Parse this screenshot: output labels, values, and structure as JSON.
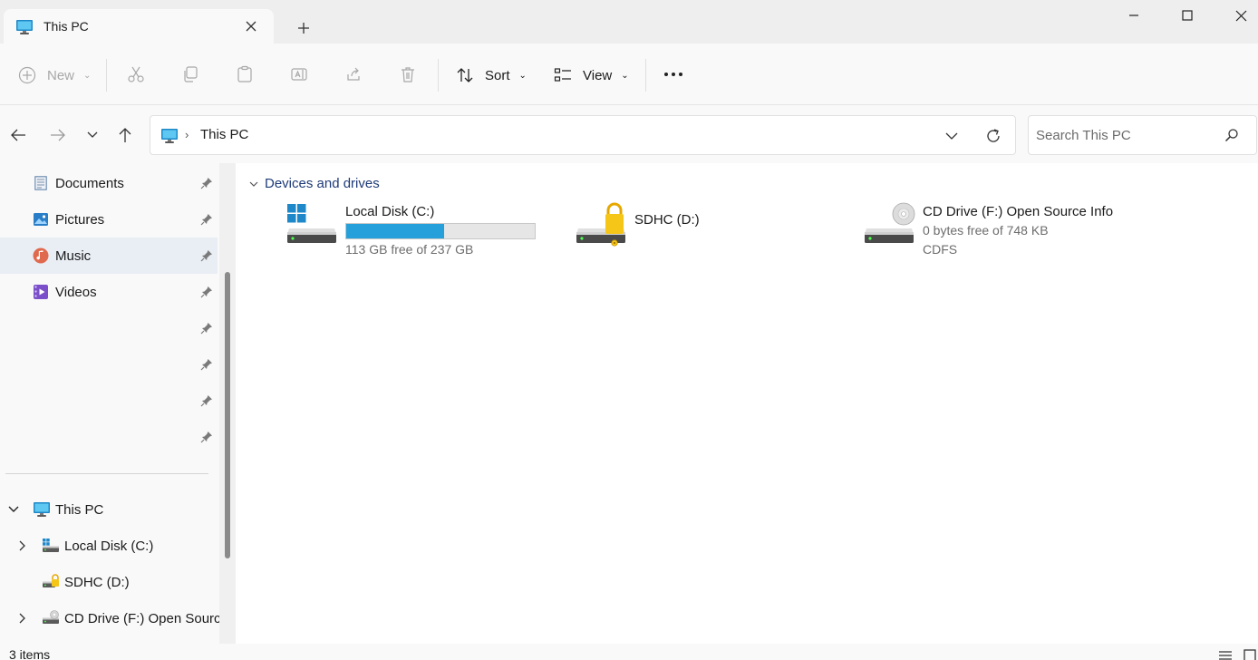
{
  "window": {
    "tab_title": "This PC",
    "colors": {
      "accent": "#26a0da",
      "selection": "#cce4f7",
      "group_header": "#1e3a78"
    }
  },
  "toolbar": {
    "new_label": "New",
    "sort_label": "Sort",
    "view_label": "View"
  },
  "address": {
    "crumbs": [
      "This PC"
    ],
    "search_placeholder": "Search This PC"
  },
  "sidebar": {
    "quick_access": [
      {
        "label": "Documents",
        "icon": "documents-icon"
      },
      {
        "label": "Pictures",
        "icon": "pictures-icon"
      },
      {
        "label": "Music",
        "icon": "music-icon"
      },
      {
        "label": "Videos",
        "icon": "videos-icon"
      },
      {
        "label": "",
        "icon": ""
      },
      {
        "label": "",
        "icon": ""
      },
      {
        "label": "",
        "icon": ""
      },
      {
        "label": "",
        "icon": ""
      }
    ],
    "tree": [
      {
        "label": "This PC",
        "icon": "computer-icon",
        "expanded": true
      },
      {
        "label": "Local Disk (C:)",
        "icon": "windows-drive-icon"
      },
      {
        "label": "SDHC (D:)",
        "icon": "locked-drive-icon"
      },
      {
        "label": "CD Drive (F:) Open Source Info",
        "icon": "cd-drive-icon"
      }
    ]
  },
  "main": {
    "group_label": "Devices and drives",
    "drives": [
      {
        "name": "Local Disk (C:)",
        "free_text": "113 GB free of 237 GB",
        "used_fraction": 0.52,
        "icon": "windows-drive-icon"
      },
      {
        "name": "SDHC (D:)",
        "icon": "locked-drive-icon"
      },
      {
        "name": "CD Drive (F:) Open Source Info",
        "free_text": "0 bytes free of 748 KB",
        "filesystem": "CDFS",
        "icon": "cd-drive-icon"
      }
    ]
  },
  "status": {
    "item_count": "3 items"
  }
}
